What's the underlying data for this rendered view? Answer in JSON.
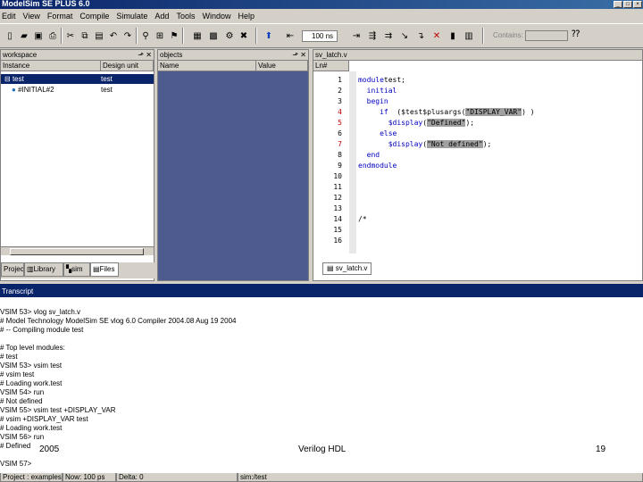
{
  "window": {
    "title": "ModelSim SE PLUS 6.0"
  },
  "menu": [
    "Edit",
    "View",
    "Format",
    "Compile",
    "Simulate",
    "Add",
    "Tools",
    "Window",
    "Help"
  ],
  "toolbar": {
    "run_length": "100 ns",
    "contains_label": "Contains:"
  },
  "workspace": {
    "title": "workspace",
    "col_instance": "Instance",
    "col_design_unit": "Design unit",
    "rows": [
      {
        "instance": "test",
        "design_unit": "test",
        "selected": true
      },
      {
        "instance": "#INITIAL#2",
        "design_unit": "test",
        "selected": false
      }
    ],
    "tabs": [
      "Project",
      "Library",
      "sim",
      "Files"
    ]
  },
  "objects": {
    "title": "objects",
    "col_name": "Name",
    "col_value": "Value"
  },
  "source": {
    "title": "sv_latch.v",
    "col_ln": "Ln#",
    "tab": "sv_latch.v",
    "line_numbers": [
      "1",
      "2",
      "3",
      "4",
      "5",
      "6",
      "7",
      "8",
      "9",
      "10",
      "11",
      "12",
      "13",
      "14",
      "15",
      "16"
    ],
    "code": [
      {
        "parts": [
          [
            "kw",
            "module"
          ],
          [
            "",
            "test;"
          ]
        ]
      },
      {
        "parts": [
          [
            "",
            "  "
          ],
          [
            "kw",
            "initial"
          ]
        ]
      },
      {
        "parts": [
          [
            "",
            "  "
          ],
          [
            "kw",
            "begin"
          ]
        ]
      },
      {
        "parts": [
          [
            "",
            "     "
          ],
          [
            "kw",
            "if"
          ],
          [
            "",
            "  ($test$plusargs("
          ],
          [
            "str",
            "\"DISPLAY_VAR\""
          ],
          [
            "",
            ") )"
          ]
        ]
      },
      {
        "parts": [
          [
            "",
            "       "
          ],
          [
            "kw",
            "$display"
          ],
          [
            "",
            "("
          ],
          [
            "str",
            "\"Defined\""
          ],
          [
            "",
            ");"
          ]
        ]
      },
      {
        "parts": [
          [
            "",
            "     "
          ],
          [
            "kw",
            "else"
          ]
        ]
      },
      {
        "parts": [
          [
            "",
            "       "
          ],
          [
            "kw",
            "$display"
          ],
          [
            "",
            "("
          ],
          [
            "str",
            "\"Not defined\""
          ],
          [
            "",
            ");"
          ]
        ]
      },
      {
        "parts": [
          [
            "",
            "  "
          ],
          [
            "kw",
            "end"
          ]
        ]
      },
      {
        "parts": [
          [
            "kw",
            "endmodule"
          ]
        ]
      },
      {
        "parts": []
      },
      {
        "parts": []
      },
      {
        "parts": []
      },
      {
        "parts": []
      },
      {
        "parts": [
          [
            "",
            "/*"
          ]
        ]
      },
      {
        "parts": []
      },
      {
        "parts": []
      }
    ]
  },
  "transcript": {
    "title": "Transcript",
    "lines": [
      "VSIM 53> vlog sv_latch.v",
      "# Model Technology ModelSim SE vlog 6.0 Compiler 2004.08 Aug 19 2004",
      "# -- Compiling module test",
      "",
      "# Top level modules:",
      "#     test",
      "VSIM 53> vsim test",
      "# vsim test",
      "# Loading work.test",
      "VSIM 54> run",
      "# Not defined",
      "VSIM 55> vsim test +DISPLAY_VAR",
      "# vsim +DISPLAY_VAR test",
      "# Loading work.test",
      "VSIM 56> run",
      "# Defined",
      "",
      "VSIM 57>"
    ]
  },
  "footer": {
    "year": "2005",
    "subject": "Verilog HDL",
    "page": "19"
  },
  "statusbar": {
    "project": "Project : examples",
    "now": "Now: 100 ps",
    "delta": "Delta: 0",
    "context": "sim:/test"
  }
}
